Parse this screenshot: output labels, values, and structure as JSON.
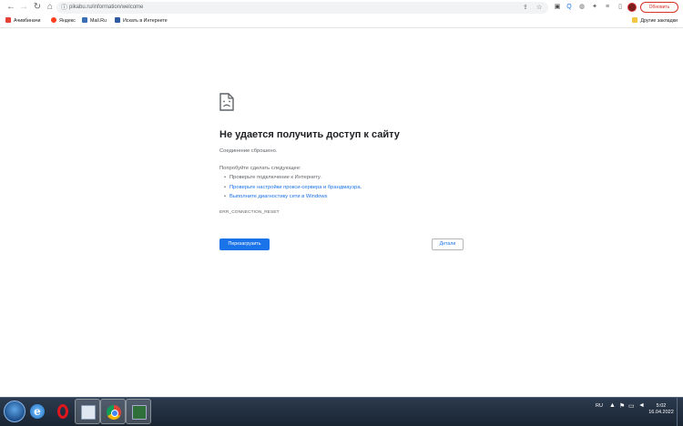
{
  "browser": {
    "url": "pikabu.ru/information/welcome",
    "update_button": "Обновить",
    "icons": [
      "back-icon",
      "forward-icon",
      "reload-icon",
      "home-icon",
      "info-icon"
    ]
  },
  "bookmarks": {
    "items": [
      {
        "label": "Ачивбиначи",
        "icon": "bookmark-icon",
        "color": "#e34234"
      },
      {
        "label": "Яндекс",
        "icon": "yandex-icon",
        "color": "#fc3f1d"
      },
      {
        "label": "Mail.Ru",
        "icon": "mailru-icon",
        "color": "#3a6fb5"
      },
      {
        "label": "Искать в Интернете",
        "icon": "search-icon",
        "color": "#2d5aa0"
      }
    ],
    "other": "Другие закладки"
  },
  "error": {
    "title": "Не удается получить доступ к сайту",
    "description": "Соединение сброшено.",
    "try_label": "Попробуйте сделать следующее:",
    "suggestions": [
      {
        "text": "Проверьте подключение к Интернету.",
        "link": false
      },
      {
        "text": "Проверьте настройки прокси-сервера и брандмауэра.",
        "link": true
      },
      {
        "text": "Выполните диагностику сети в Windows",
        "link": true
      }
    ],
    "code": "ERR_CONNECTION_RESET",
    "reload_button": "Перезагрузить",
    "details_button": "Детали"
  },
  "taskbar": {
    "language": "RU",
    "time": "5:02",
    "date": "16.04.2022",
    "apps": [
      "internet-explorer",
      "opera",
      "file-manager",
      "chrome",
      "cmd"
    ]
  },
  "colors": {
    "accent": "#1a73e8",
    "update": "#d93025"
  }
}
